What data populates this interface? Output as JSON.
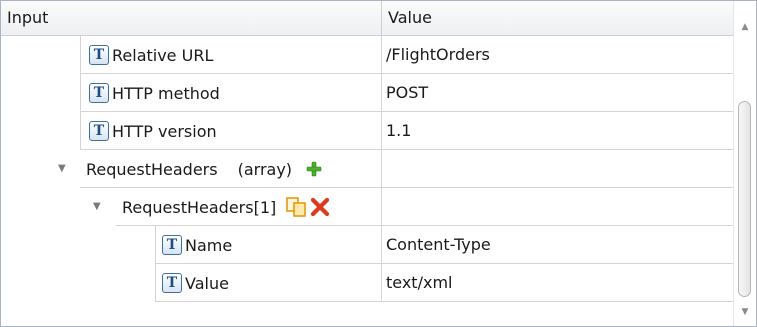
{
  "header": {
    "input_label": "Input",
    "value_label": "Value"
  },
  "rows": [
    {
      "label": "Relative URL",
      "value": "/FlightOrders",
      "icon": "text-type-icon"
    },
    {
      "label": "HTTP method",
      "value": "POST",
      "icon": "text-type-icon"
    },
    {
      "label": "HTTP version",
      "value": "1.1",
      "icon": "text-type-icon"
    },
    {
      "label": "RequestHeaders",
      "type": "(array)",
      "value": "",
      "icon": "add-icon",
      "expanded": true
    },
    {
      "label": "RequestHeaders[1]",
      "value": "",
      "icons": [
        "copy-icon",
        "delete-icon"
      ],
      "expanded": true
    },
    {
      "label": "Name",
      "value": "Content-Type",
      "icon": "text-type-icon"
    },
    {
      "label": "Value",
      "value": "text/xml",
      "icon": "text-type-icon"
    }
  ],
  "icon_glyph": "T",
  "colors": {
    "add_icon": "#4caf2a",
    "delete_icon": "#e03a1e",
    "copy_icon": "#f0a020",
    "type_icon_border": "#3b6fa6"
  }
}
